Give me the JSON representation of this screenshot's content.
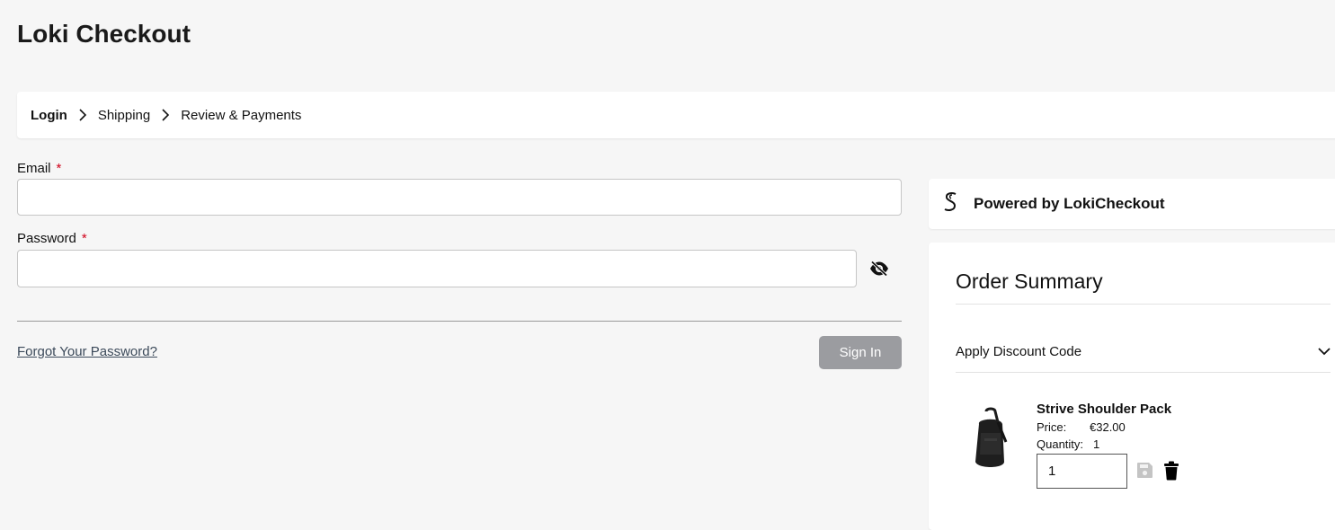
{
  "page": {
    "title": "Loki Checkout"
  },
  "steps": [
    {
      "label": "Login",
      "active": true
    },
    {
      "label": "Shipping",
      "active": false
    },
    {
      "label": "Review & Payments",
      "active": false
    }
  ],
  "login": {
    "email_label": "Email",
    "email_value": "",
    "password_label": "Password",
    "password_value": "",
    "required_marker": "*",
    "forgot_link": "Forgot Your Password?",
    "signin_button": "Sign In"
  },
  "powered": {
    "text": "Powered by LokiCheckout",
    "logo_glyph": "S"
  },
  "summary": {
    "title": "Order Summary",
    "discount_label": "Apply Discount Code",
    "item": {
      "name": "Strive Shoulder Pack",
      "price_label": "Price:",
      "price_value": "€32.00",
      "quantity_label": "Quantity:",
      "quantity_value": "1",
      "quantity_input": "1"
    }
  },
  "colors": {
    "background": "#f6f6f6",
    "required": "#d0021b",
    "signin_button": "#9b9ca0",
    "link": "#3c4a5a"
  },
  "icons": [
    "chevron-right-icon",
    "eye-slash-icon",
    "loki-logo-icon",
    "chevron-down-icon",
    "save-icon",
    "trash-icon",
    "product-image"
  ]
}
